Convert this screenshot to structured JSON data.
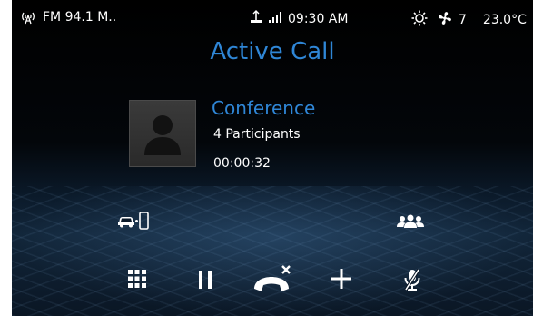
{
  "status_bar": {
    "radio_icon": "radio-antenna-icon",
    "radio_label": "FM 94.1 M..",
    "usb_icon": "usb-icon",
    "signal_icon": "signal-bars-icon",
    "time": "09:30 AM",
    "climate_icon": "sun-icon",
    "fan_icon": "fan-icon",
    "fan_speed": "7",
    "temperature": "23.0°C"
  },
  "call": {
    "title": "Active Call",
    "caller_name": "Conference",
    "participants": "4 Participants",
    "duration": "00:00:32",
    "avatar_icon": "person-silhouette-icon"
  },
  "actions": {
    "transfer_icon": "car-to-phone-icon",
    "participants_icon": "group-icon",
    "keypad_icon": "keypad-icon",
    "hold_icon": "pause-icon",
    "end_call_icon": "end-call-icon",
    "add_call_icon": "plus-icon",
    "mute_icon": "mute-mic-icon"
  },
  "colors": {
    "accent": "#2f86d6",
    "text": "#ffffff"
  }
}
